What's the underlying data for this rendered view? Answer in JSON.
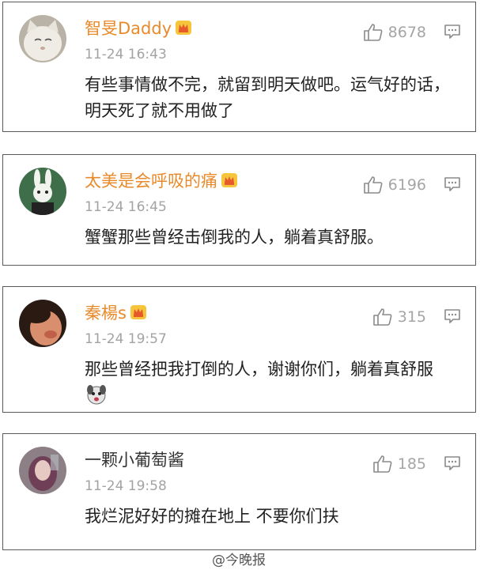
{
  "comments": [
    {
      "username": "智旻Daddy",
      "username_color": "#e98a2a",
      "has_vip_badge": true,
      "time": "11-24 16:43",
      "likes": "8678",
      "text": "有些事情做不完，就留到明天做吧。运气好的话，明天死了就不用做了",
      "avatar": "white-cat-avatar"
    },
    {
      "username": "太美是会呼吸的痛",
      "username_color": "#e98a2a",
      "has_vip_badge": true,
      "time": "11-24 16:45",
      "likes": "6196",
      "text": "蟹蟹那些曾经击倒我的人，躺着真舒服。",
      "avatar": "rabbit-avatar"
    },
    {
      "username": "秦楊s",
      "username_color": "#e98a2a",
      "has_vip_badge": true,
      "time": "11-24 19:57",
      "likes": "315",
      "text": "那些曾经把我打倒的人，谢谢你们，躺着真舒服",
      "avatar": "person-avatar",
      "emoji": "dog-face-emoji"
    },
    {
      "username": "一颗小葡萄酱",
      "username_color": "#333333",
      "has_vip_badge": false,
      "time": "11-24 19:58",
      "likes": "185",
      "text": "我烂泥好好的摊在地上 不要你们扶",
      "avatar": "girl-avatar"
    }
  ],
  "watermark": "@今晚报",
  "colors": {
    "meta_gray": "#a3a3a3",
    "border": "#5a5a5a",
    "vip_orange": "#e98a2a"
  }
}
